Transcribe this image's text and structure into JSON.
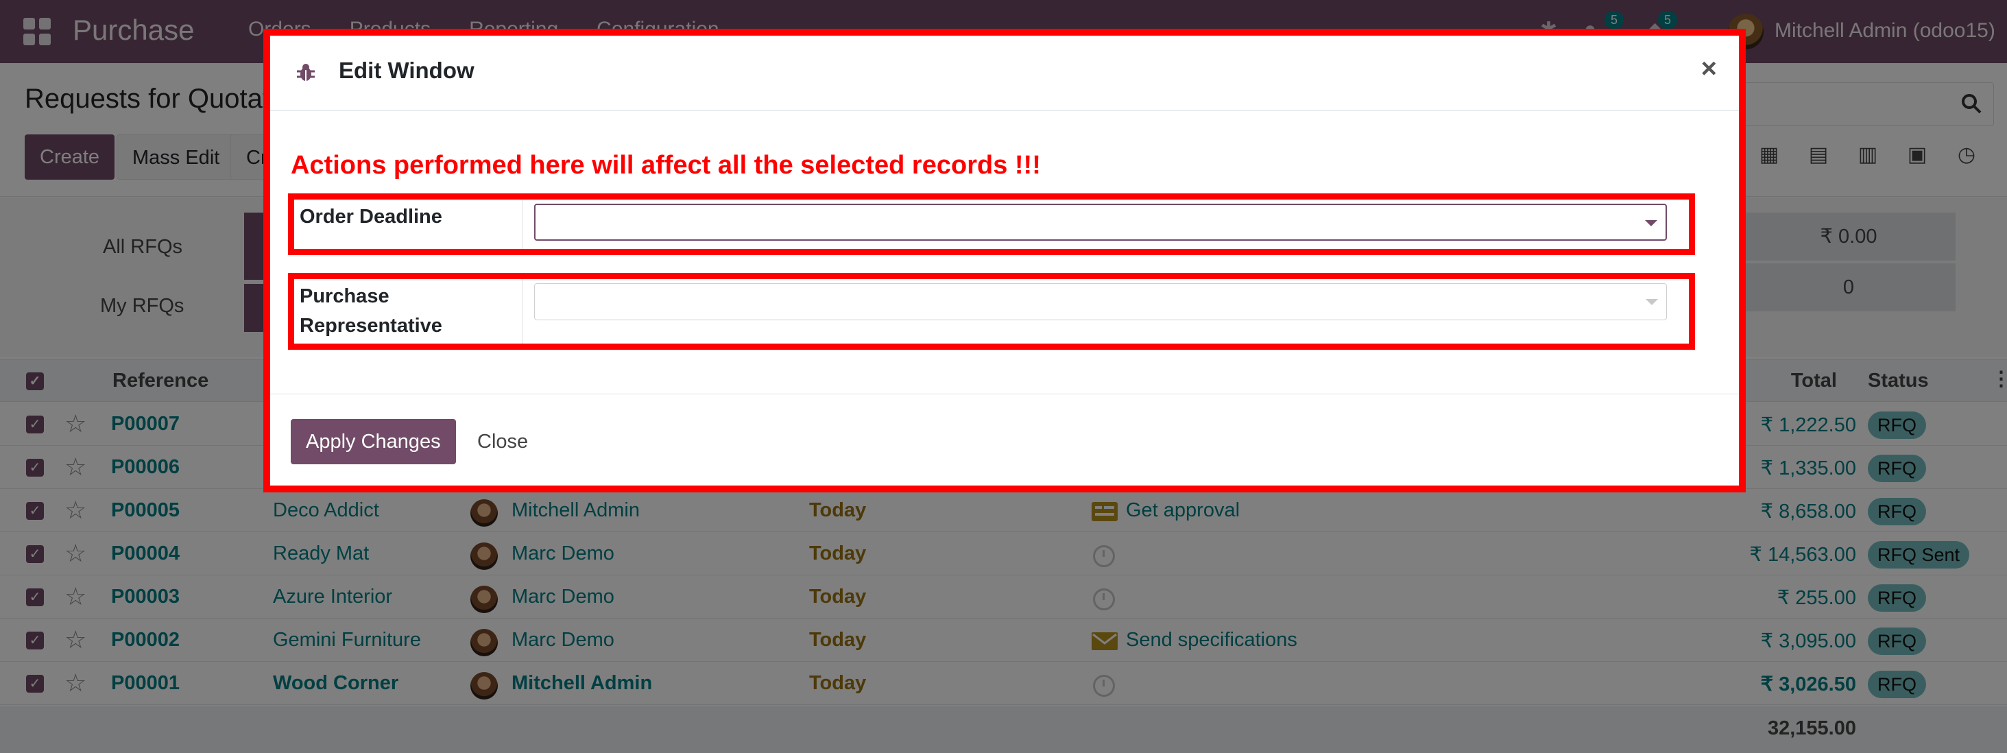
{
  "navbar": {
    "app_name": "Purchase",
    "menu": [
      "Orders",
      "Products",
      "Reporting",
      "Configuration"
    ],
    "chat_count": "5",
    "activity_count": "5",
    "user": "Mitchell Admin (odoo15)"
  },
  "control_panel": {
    "breadcrumb": "Requests for Quotation",
    "create_label": "Create",
    "mass_edit_label": "Mass Edit",
    "third_button_label": "Cr"
  },
  "dashboard": {
    "all_rfqs": "All RFQs",
    "my_rfqs": "My RFQs",
    "amount": "₹ 0.00",
    "count": "0"
  },
  "list": {
    "headers": {
      "reference": "Reference",
      "total": "Total",
      "status": "Status"
    },
    "rows": [
      {
        "ref": "P00007",
        "vendor": "",
        "user": "",
        "deadline": "",
        "activity": "",
        "total": "₹ 1,222.50",
        "status": "RFQ"
      },
      {
        "ref": "P00006",
        "vendor": "",
        "user": "",
        "deadline": "",
        "activity": "",
        "total": "₹ 1,335.00",
        "status": "RFQ"
      },
      {
        "ref": "P00005",
        "vendor": "Deco Addict",
        "user": "Mitchell Admin",
        "deadline": "Today",
        "activity": "Get approval",
        "total": "₹ 8,658.00",
        "status": "RFQ"
      },
      {
        "ref": "P00004",
        "vendor": "Ready Mat",
        "user": "Marc Demo",
        "deadline": "Today",
        "activity": "",
        "total": "₹ 14,563.00",
        "status": "RFQ Sent"
      },
      {
        "ref": "P00003",
        "vendor": "Azure Interior",
        "user": "Marc Demo",
        "deadline": "Today",
        "activity": "",
        "total": "₹ 255.00",
        "status": "RFQ"
      },
      {
        "ref": "P00002",
        "vendor": "Gemini Furniture",
        "user": "Marc Demo",
        "deadline": "Today",
        "activity": "Send specifications",
        "total": "₹ 3,095.00",
        "status": "RFQ"
      },
      {
        "ref": "P00001",
        "vendor": "Wood Corner",
        "user": "Mitchell Admin",
        "deadline": "Today",
        "activity": "",
        "total": "₹ 3,026.50",
        "status": "RFQ"
      }
    ],
    "grand_total": "32,155.00"
  },
  "modal": {
    "title": "Edit Window",
    "close_symbol": "×",
    "warning": "Actions performed here will affect all the selected records !!!",
    "field1_label": "Order Deadline",
    "field1_value": "",
    "field2_label_line1": "Purchase",
    "field2_label_line2": "Representative",
    "field2_value": "",
    "apply_label": "Apply Changes",
    "close_label": "Close"
  },
  "colors": {
    "brand": "#714B67",
    "link": "#017e84",
    "highlight": "#ff0000",
    "deadline": "#9a7312"
  },
  "icons": [
    "apps-grid-icon",
    "bug-icon",
    "search-icon",
    "star-icon",
    "clock-icon",
    "close-icon",
    "caret-down-icon"
  ]
}
